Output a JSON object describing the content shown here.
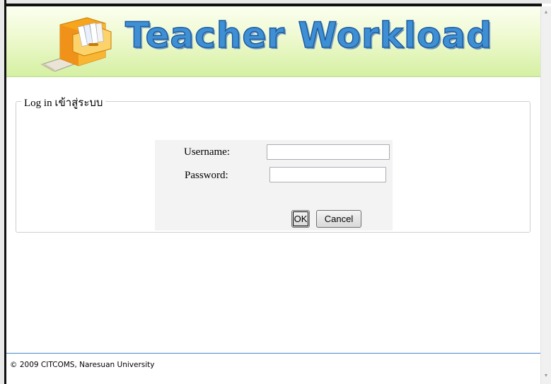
{
  "header": {
    "title": "Teacher Workload",
    "logo_icon": "file-cabinet-icon"
  },
  "login": {
    "legend": "Log in เข้าสู่ระบบ",
    "username_label": "Username:",
    "username_value": "",
    "password_label": "Password:",
    "password_value": "",
    "ok_label": "OK",
    "cancel_label": "Cancel"
  },
  "footer": {
    "copyright": "© 2009 CITCOMS, Naresuan University"
  },
  "scrollbar": {
    "up_icon": "scroll-up-arrow-icon",
    "down_icon": "scroll-down-arrow-icon"
  },
  "colors": {
    "banner_top": "#fbfff0",
    "banner_bottom": "#d5f0a2",
    "title_blue": "#3f8fd4",
    "footer_line": "#4c88c9",
    "login_box_bg": "#f3f3f3"
  }
}
